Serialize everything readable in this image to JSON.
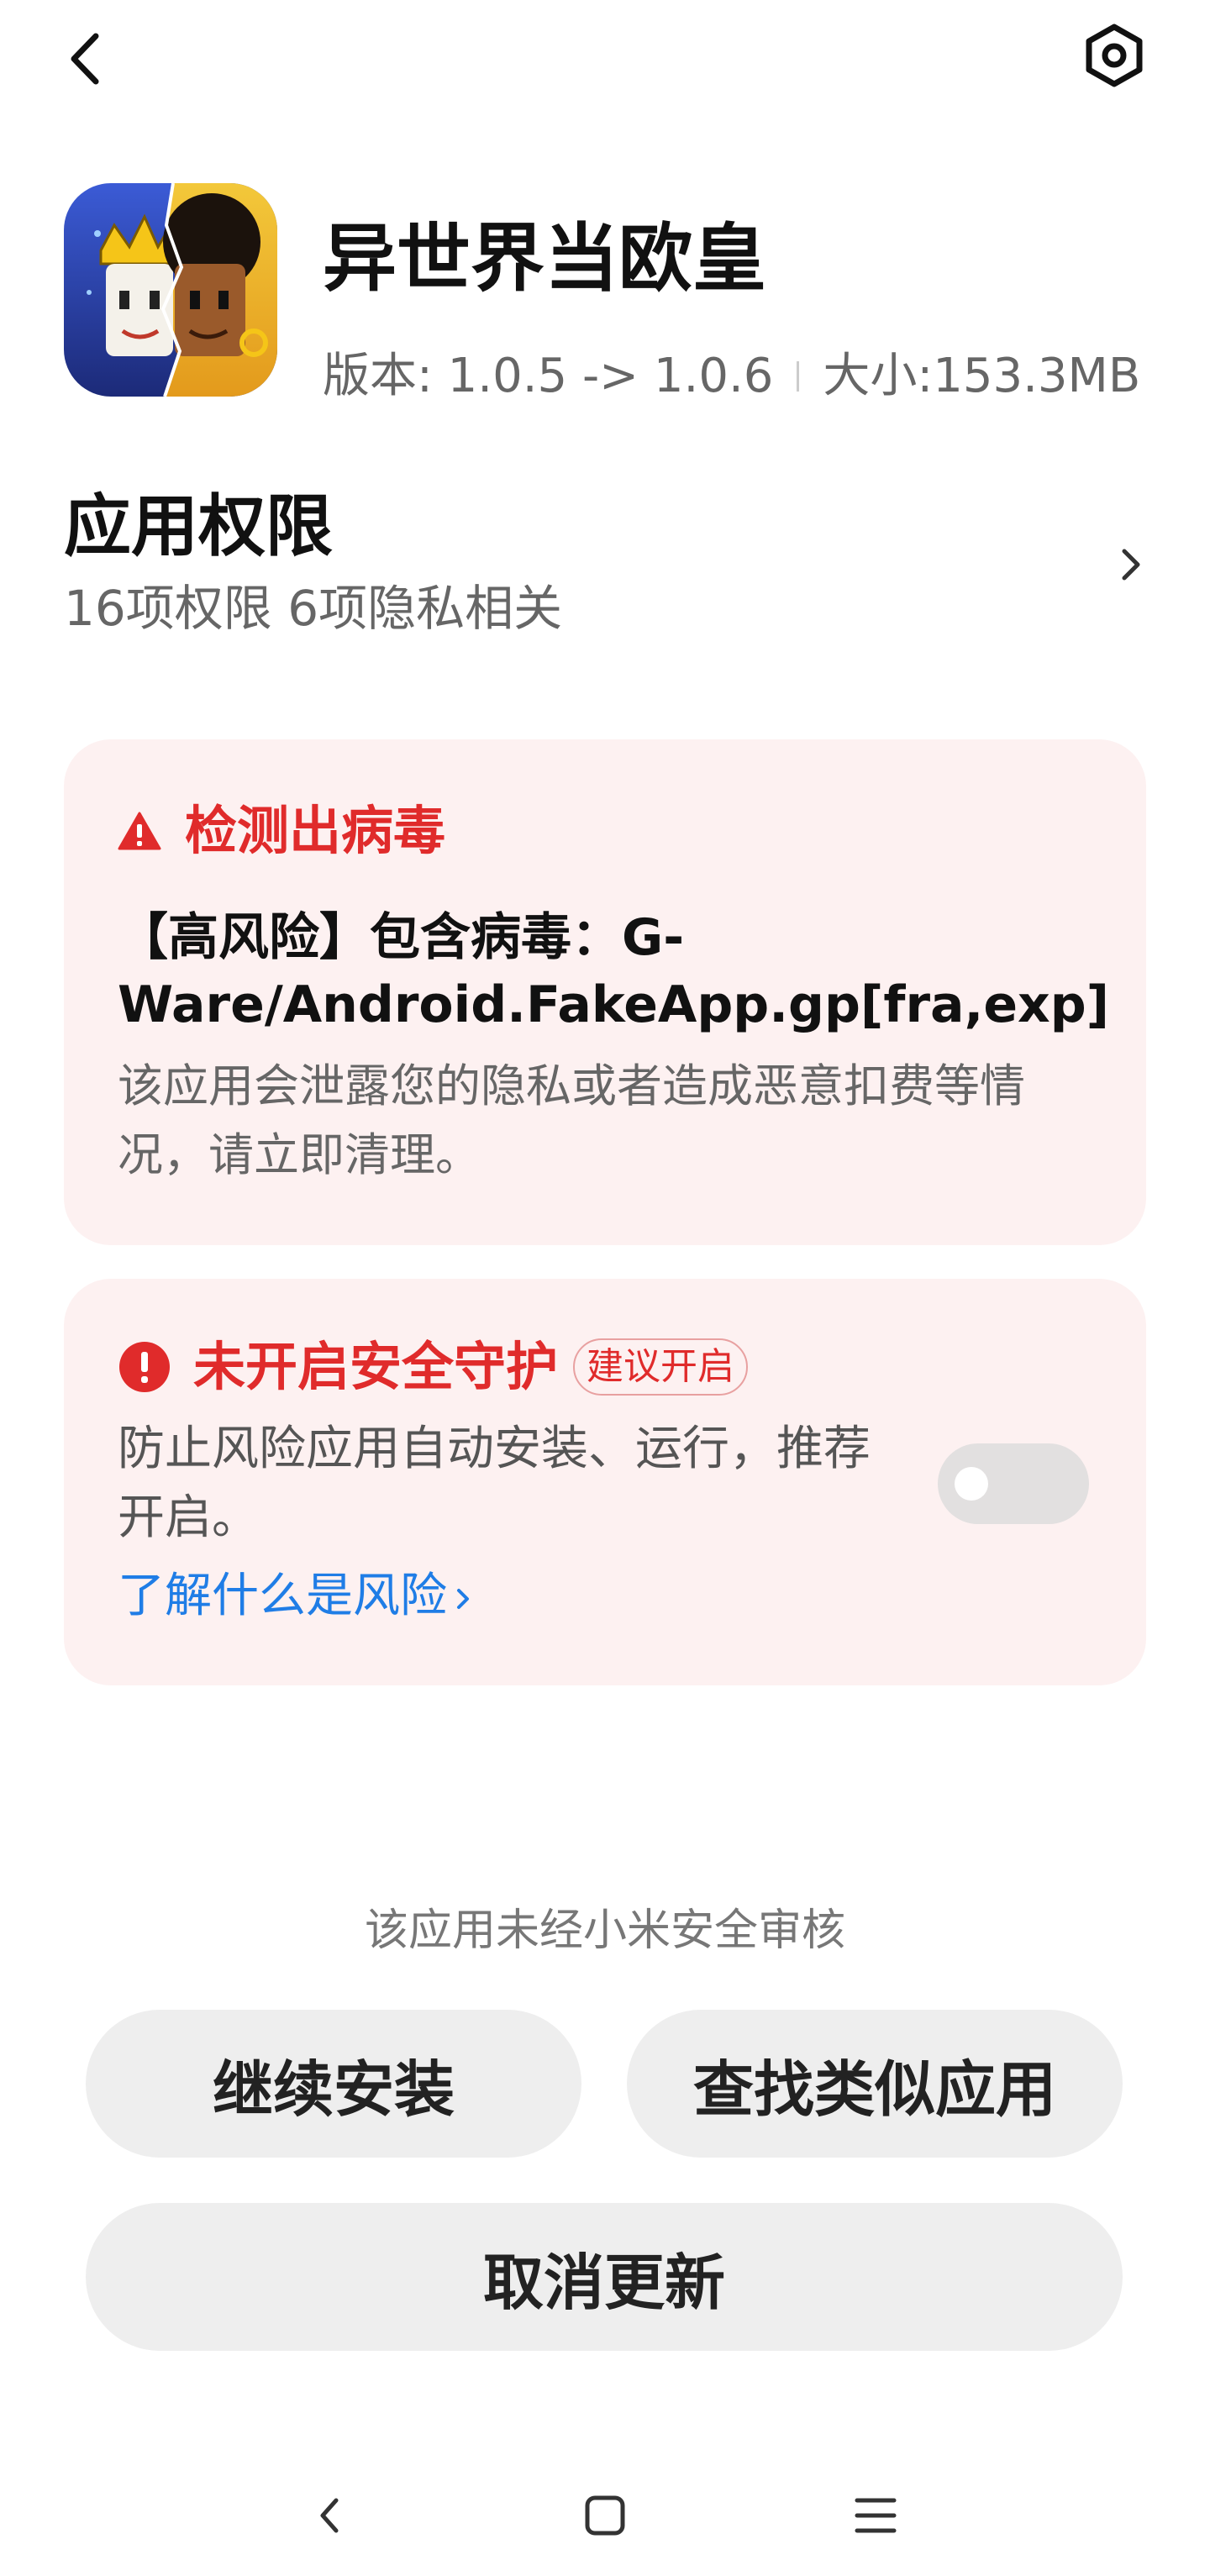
{
  "app": {
    "name": "异世界当欧皇",
    "version": "版本: 1.0.5 -> 1.0.6",
    "size": "大小:153.3MB"
  },
  "permissions": {
    "title": "应用权限",
    "summary": "16项权限 6项隐私相关"
  },
  "virus_card": {
    "title": "检测出病毒",
    "detail": "【高风险】包含病毒：G-Ware/Android.FakeApp.gp[fra,exp]",
    "description": "该应用会泄露您的隐私或者造成恶意扣费等情况，请立即清理。"
  },
  "protection_card": {
    "title": "未开启安全守护",
    "badge": "建议开启",
    "description": "防止风险应用自动安装、运行，推荐开启。",
    "toggle_on": false,
    "link": "了解什么是风险"
  },
  "notice": "该应用未经小米安全审核",
  "buttons": {
    "continue": "继续安装",
    "find_similar": "查找类似应用",
    "cancel": "取消更新"
  },
  "colors": {
    "danger": "#e02b2b",
    "link": "#1f7de6",
    "card_bg": "#fdf1f1",
    "button_bg": "#eeeeee"
  },
  "icons": {
    "back": "chevron-left-icon",
    "settings": "hexagon-gear-icon",
    "permissions": "chevron-right-icon",
    "virus": "warning-triangle-icon",
    "protection": "exclamation-circle-icon",
    "nav": [
      "nav-back-icon",
      "nav-home-icon",
      "nav-menu-icon"
    ]
  }
}
